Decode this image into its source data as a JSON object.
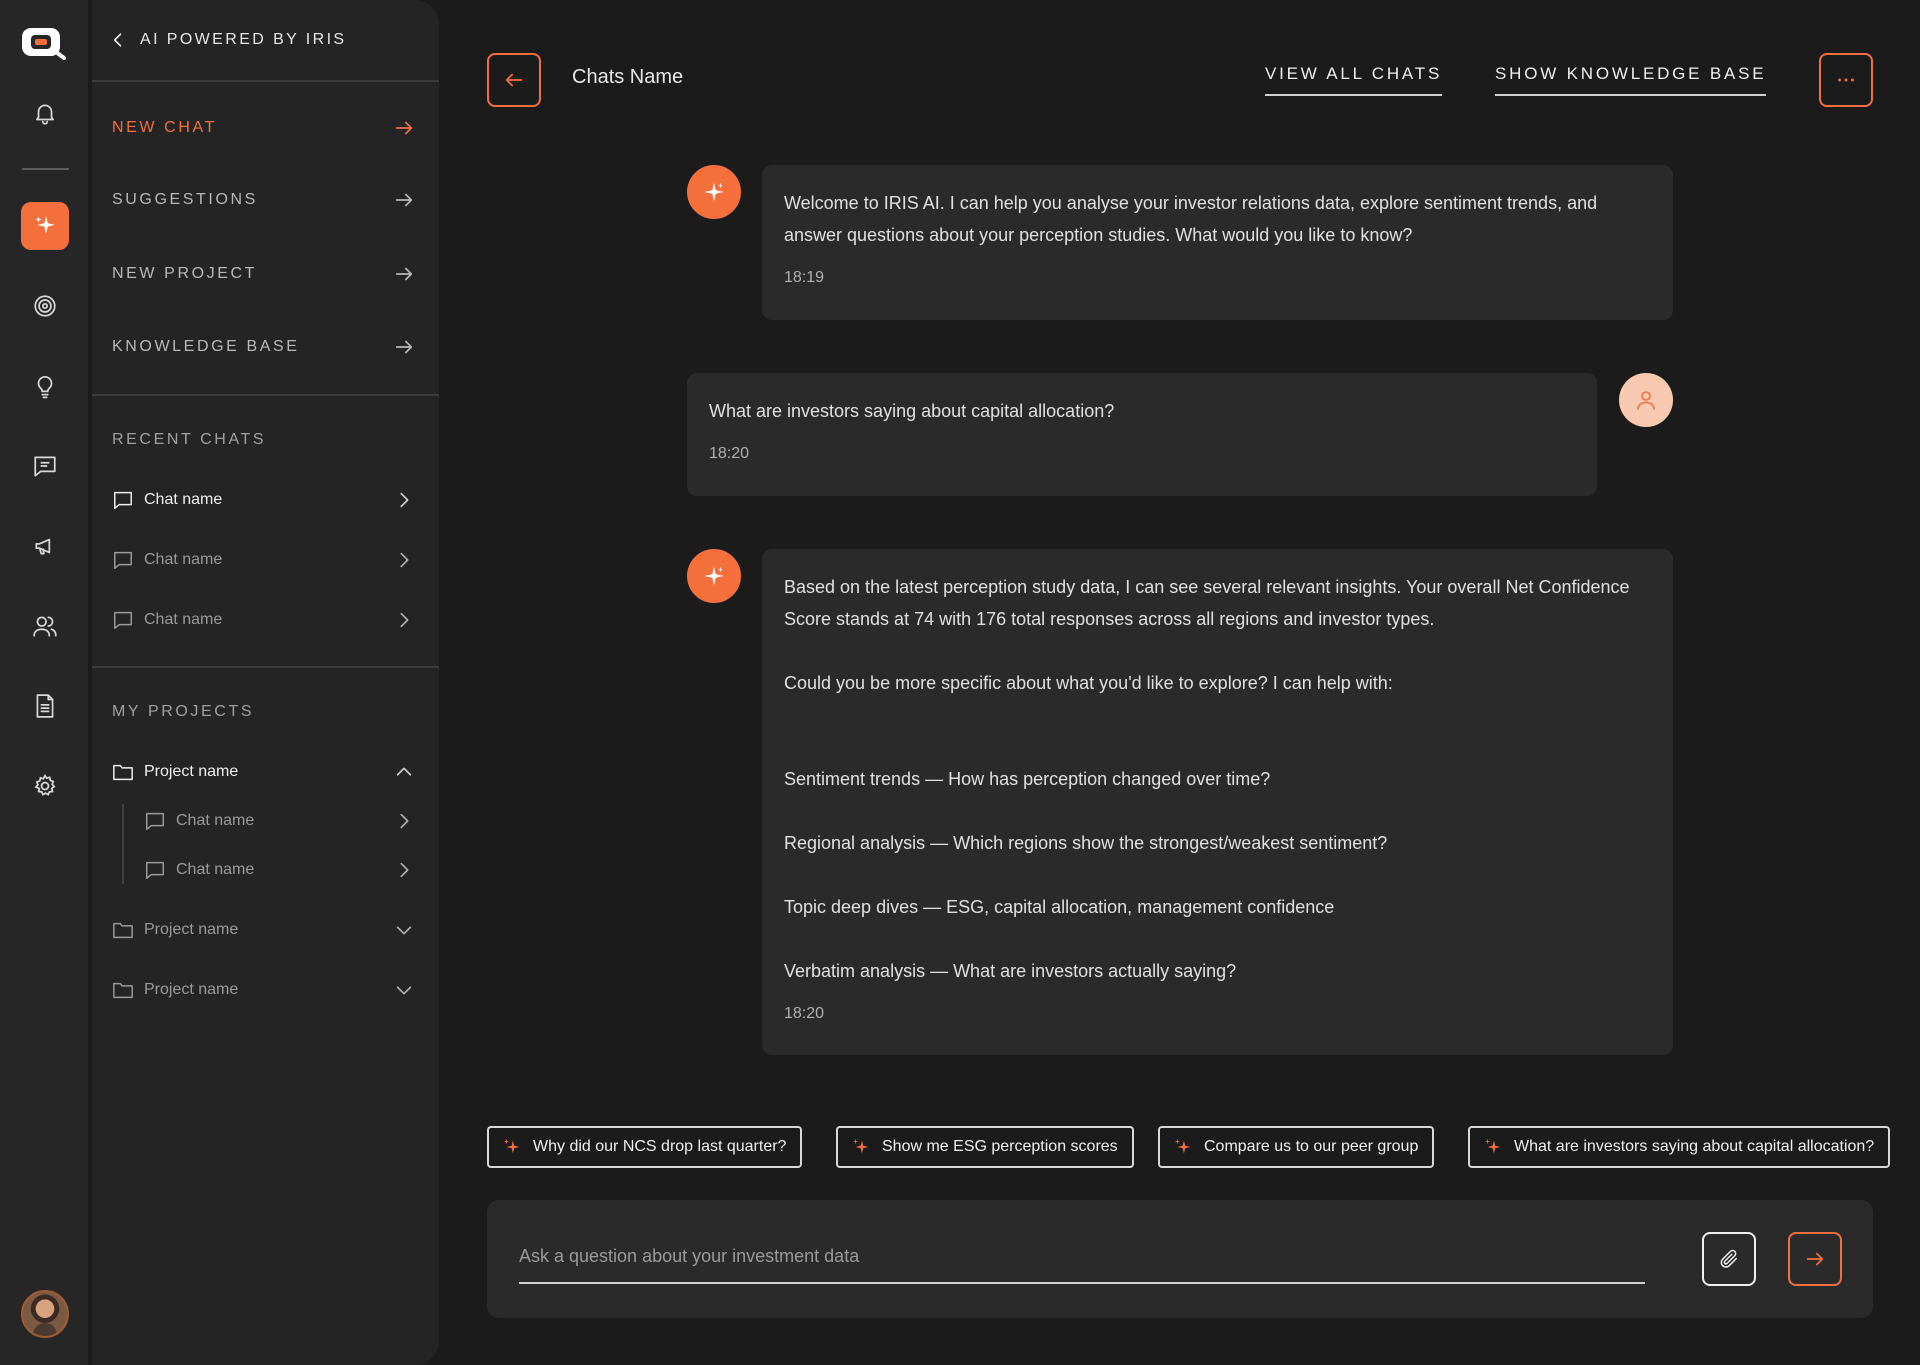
{
  "colors": {
    "accent": "#f46f3b",
    "background": "#1b1b1b",
    "panel": "#242424",
    "bubble": "#2a2a2a"
  },
  "rail": {
    "items": [
      {
        "icon": "bell-icon"
      },
      {
        "icon": "sparkle-icon",
        "active": true
      },
      {
        "icon": "target-icon"
      },
      {
        "icon": "lightbulb-icon"
      },
      {
        "icon": "message-square-icon"
      },
      {
        "icon": "megaphone-icon"
      },
      {
        "icon": "users-icon"
      },
      {
        "icon": "document-icon"
      },
      {
        "icon": "gear-icon"
      }
    ]
  },
  "panel": {
    "header": "AI POWERED BY IRIS",
    "menu": [
      {
        "label": "NEW CHAT"
      },
      {
        "label": "SUGGESTIONS"
      },
      {
        "label": "NEW PROJECT"
      },
      {
        "label": "KNOWLEDGE BASE"
      }
    ],
    "recent_title": "RECENT CHATS",
    "recent": [
      {
        "label": "Chat name"
      },
      {
        "label": "Chat name"
      },
      {
        "label": "Chat name"
      }
    ],
    "projects_title": "MY PROJECTS",
    "projects": [
      {
        "label": "Project name",
        "expanded": true,
        "chats": [
          "Chat name",
          "Chat name"
        ]
      },
      {
        "label": "Project name",
        "expanded": false
      },
      {
        "label": "Project name",
        "expanded": false
      }
    ]
  },
  "header": {
    "chat_title": "Chats Name",
    "view_all": "VIEW ALL CHATS",
    "show_kb": "SHOW KNOWLEDGE BASE"
  },
  "messages": [
    {
      "role": "assistant",
      "text": "Welcome to IRIS AI. I can help you analyse your investor relations data, explore sentiment trends, and answer questions about your perception studies. What would you like to know?",
      "time": "18:19"
    },
    {
      "role": "user",
      "text": "What are investors saying about capital allocation?",
      "time": "18:20"
    },
    {
      "role": "assistant",
      "intro": "Based on the latest perception study data, I can see several relevant insights. Your overall Net Confidence Score stands at 74 with 176 total responses across all regions and investor types.",
      "question": "Could you be more specific about what you'd like to explore? I can help with:",
      "options": [
        "Sentiment trends — How has perception changed over time?",
        "Regional analysis — Which regions show the strongest/weakest sentiment?",
        "Topic deep dives — ESG, capital allocation, management confidence",
        "Verbatim analysis — What are investors actually saying?"
      ],
      "time": "18:20"
    }
  ],
  "suggestions": [
    "Why did our NCS drop last quarter?",
    "Show me ESG perception scores",
    "Compare us to our peer group",
    "What are investors saying about capital allocation?"
  ],
  "composer": {
    "placeholder": "Ask a question about your investment data"
  }
}
